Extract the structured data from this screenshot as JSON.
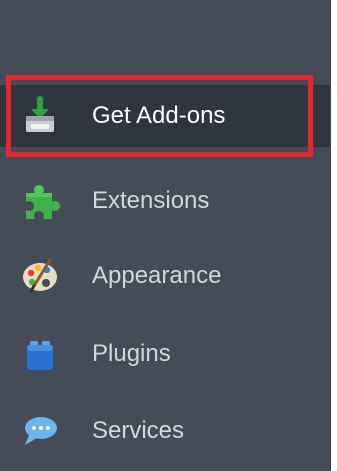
{
  "sidebar": {
    "items": [
      {
        "label": "Get Add-ons",
        "icon": "download-tray-icon",
        "selected": true
      },
      {
        "label": "Extensions",
        "icon": "puzzle-piece-icon",
        "selected": false
      },
      {
        "label": "Appearance",
        "icon": "paint-palette-icon",
        "selected": false
      },
      {
        "label": "Plugins",
        "icon": "lego-brick-icon",
        "selected": false
      },
      {
        "label": "Services",
        "icon": "chat-bubble-icon",
        "selected": false
      }
    ]
  },
  "colors": {
    "sidebar_background": "#434c57",
    "selected_background": "#2f3640",
    "highlight_border": "#e8262c",
    "label_text": "#d2d7dd"
  }
}
